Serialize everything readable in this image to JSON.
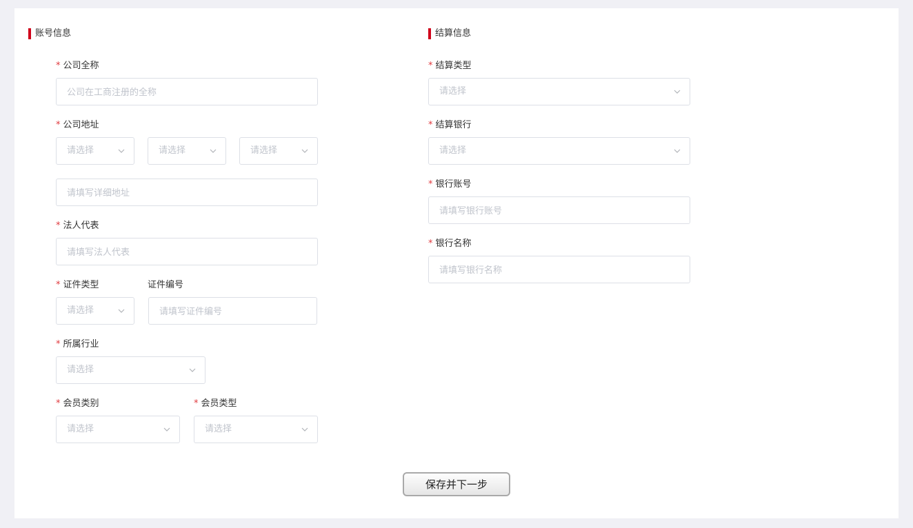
{
  "account_section": {
    "title": "账号信息",
    "company_name": {
      "label": "公司全称",
      "placeholder": "公司在工商注册的全称"
    },
    "company_address": {
      "label": "公司地址",
      "province_placeholder": "请选择",
      "city_placeholder": "请选择",
      "district_placeholder": "请选择",
      "detail_placeholder": "请填写详细地址"
    },
    "legal_rep": {
      "label": "法人代表",
      "placeholder": "请填写法人代表"
    },
    "id_type": {
      "label": "证件类型",
      "placeholder": "请选择"
    },
    "id_number": {
      "label": "证件编号",
      "placeholder": "请填写证件编号"
    },
    "industry": {
      "label": "所属行业",
      "placeholder": "请选择"
    },
    "member_category": {
      "label": "会员类别",
      "placeholder": "请选择"
    },
    "member_type": {
      "label": "会员类型",
      "placeholder": "请选择"
    }
  },
  "settlement_section": {
    "title": "结算信息",
    "settlement_type": {
      "label": "结算类型",
      "placeholder": "请选择"
    },
    "settlement_bank": {
      "label": "结算银行",
      "placeholder": "请选择"
    },
    "bank_account": {
      "label": "银行账号",
      "placeholder": "请填写银行账号"
    },
    "bank_name": {
      "label": "银行名称",
      "placeholder": "请填写银行名称"
    }
  },
  "required_mark": "*",
  "actions": {
    "save_next_label": "保存并下一步"
  },
  "colors": {
    "accent": "#d0021b",
    "required": "#e0393e",
    "border": "#dcdfe6",
    "placeholder": "#c0c4cc"
  },
  "icons": {
    "select_arrow": "chevron-down-icon"
  }
}
